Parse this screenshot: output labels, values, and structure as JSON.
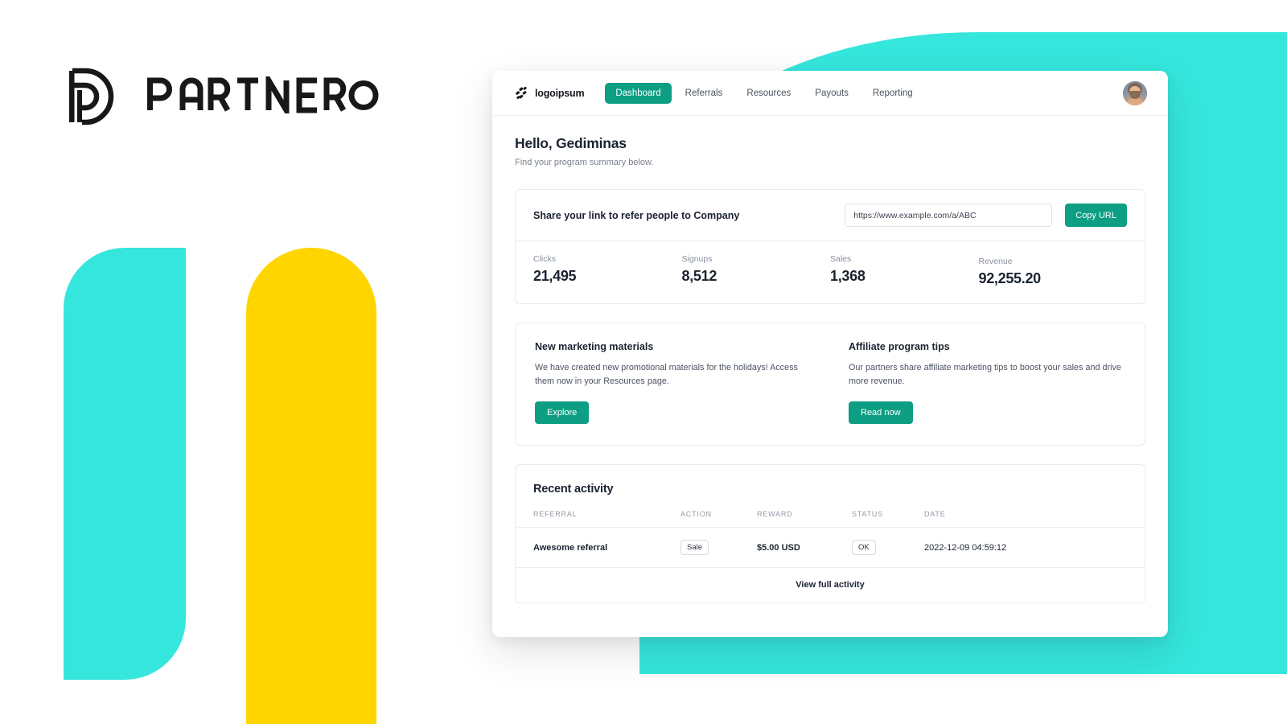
{
  "brand": {
    "name": "PARTNERO",
    "mark_icon": "partnero-p-mark-icon"
  },
  "app": {
    "header": {
      "logo_text": "logoipsum",
      "logo_icon": "logoipsum-dots-icon",
      "nav": [
        {
          "label": "Dashboard",
          "active": true
        },
        {
          "label": "Referrals",
          "active": false
        },
        {
          "label": "Resources",
          "active": false
        },
        {
          "label": "Payouts",
          "active": false
        },
        {
          "label": "Reporting",
          "active": false
        }
      ],
      "avatar_icon": "user-avatar-photo"
    },
    "greeting": {
      "title": "Hello, Gediminas",
      "subtitle": "Find your program summary below."
    },
    "share_link": {
      "label": "Share your link to refer people to Company",
      "url_value": "https://www.example.com/a/ABC",
      "url_placeholder": "https://www.example.com/a/ABC",
      "copy_button": "Copy URL"
    },
    "stats": [
      {
        "label": "Clicks",
        "value": "21,495"
      },
      {
        "label": "Signups",
        "value": "8,512"
      },
      {
        "label": "Sales",
        "value": "1,368"
      },
      {
        "label": "Revenue",
        "value": "92,255.20"
      }
    ],
    "promos": [
      {
        "title": "New marketing materials",
        "text": "We have created new promotional materials for the holidays! Access them now in your Resources page.",
        "button": "Explore"
      },
      {
        "title": "Affiliate program tips",
        "text": "Our partners share affiliate marketing tips to boost your sales and drive more revenue.",
        "button": "Read now"
      }
    ],
    "activity": {
      "title": "Recent activity",
      "columns": [
        "REFERRAL",
        "ACTION",
        "REWARD",
        "STATUS",
        "DATE"
      ],
      "rows": [
        {
          "referral": "Awesome referral",
          "action": "Sale",
          "reward": "$5.00 USD",
          "status": "OK",
          "date": "2022-12-09 04:59:12"
        }
      ],
      "footer_link": "View full activity"
    }
  },
  "colors": {
    "accent_teal": "#0E9E84",
    "decor_cyan": "#35E6DC",
    "decor_yellow": "#FFD500",
    "text_dark": "#1B2330"
  }
}
